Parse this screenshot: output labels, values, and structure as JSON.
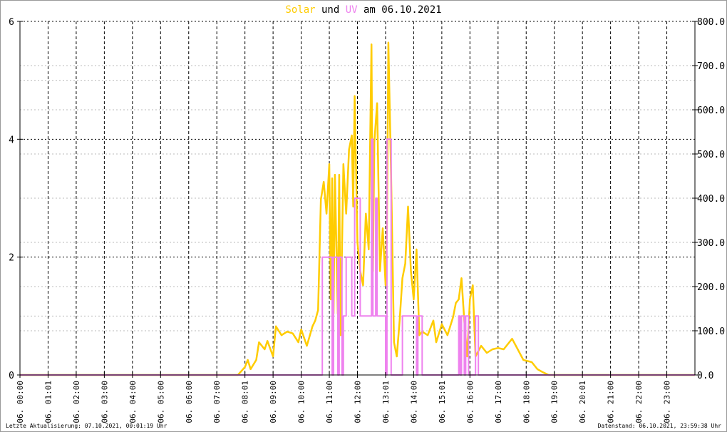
{
  "chart_data": {
    "type": "line",
    "title_parts": [
      {
        "text": "Solar",
        "color": "#ffcc00"
      },
      {
        "text": " und ",
        "color": "#000000"
      },
      {
        "text": "UV",
        "color": "#ee82ee"
      },
      {
        "text": " am 06.10.2021",
        "color": "#000000"
      }
    ],
    "x_range_hours": [
      0,
      24
    ],
    "x_ticks": [
      "06. 00:00",
      "06. 01:01",
      "06. 02:00",
      "06. 03:00",
      "06. 04:00",
      "06. 05:00",
      "06. 06:00",
      "06. 07:00",
      "06. 08:01",
      "06. 09:00",
      "06. 10:00",
      "06. 11:00",
      "06. 12:00",
      "06. 13:01",
      "06. 14:00",
      "06. 15:01",
      "06. 16:00",
      "06. 17:00",
      "06. 18:00",
      "06. 19:00",
      "06. 20:01",
      "06. 21:00",
      "06. 22:00",
      "06. 23:00"
    ],
    "y_left": {
      "range": [
        0,
        6
      ],
      "ticks": [
        "0",
        "2",
        "4",
        "6"
      ]
    },
    "y_right": {
      "range": [
        0,
        800
      ],
      "ticks": [
        "0.0",
        "100.0",
        "200.0",
        "300.0",
        "400.0",
        "500.0",
        "600.0",
        "700.0",
        "800.0"
      ]
    },
    "grid": true,
    "series": [
      {
        "name": "Solar",
        "axis": "right",
        "color": "#ffcc00",
        "points": [
          [
            0,
            0
          ],
          [
            7.75,
            0
          ],
          [
            8.0,
            18
          ],
          [
            8.1,
            34
          ],
          [
            8.2,
            13
          ],
          [
            8.4,
            34
          ],
          [
            8.5,
            74
          ],
          [
            8.7,
            58
          ],
          [
            8.8,
            77
          ],
          [
            9.0,
            42
          ],
          [
            9.1,
            110
          ],
          [
            9.3,
            90
          ],
          [
            9.5,
            98
          ],
          [
            9.7,
            94
          ],
          [
            9.9,
            74
          ],
          [
            10.0,
            103
          ],
          [
            10.2,
            66
          ],
          [
            10.4,
            110
          ],
          [
            10.5,
            123
          ],
          [
            10.6,
            147
          ],
          [
            10.7,
            397
          ],
          [
            10.8,
            437
          ],
          [
            10.9,
            365
          ],
          [
            11.0,
            477
          ],
          [
            11.05,
            171
          ],
          [
            11.1,
            445
          ],
          [
            11.15,
            139
          ],
          [
            11.2,
            453
          ],
          [
            11.3,
            139
          ],
          [
            11.35,
            453
          ],
          [
            11.4,
            90
          ],
          [
            11.5,
            477
          ],
          [
            11.6,
            365
          ],
          [
            11.7,
            510
          ],
          [
            11.8,
            542
          ],
          [
            11.85,
            381
          ],
          [
            11.9,
            631
          ],
          [
            12.0,
            300
          ],
          [
            12.1,
            235
          ],
          [
            12.2,
            203
          ],
          [
            12.3,
            365
          ],
          [
            12.4,
            284
          ],
          [
            12.5,
            748
          ],
          [
            12.55,
            235
          ],
          [
            12.6,
            526
          ],
          [
            12.7,
            615
          ],
          [
            12.8,
            235
          ],
          [
            12.9,
            332
          ],
          [
            13.0,
            203
          ],
          [
            13.05,
            332
          ],
          [
            13.1,
            752
          ],
          [
            13.2,
            445
          ],
          [
            13.3,
            74
          ],
          [
            13.4,
            42
          ],
          [
            13.5,
            123
          ],
          [
            13.6,
            219
          ],
          [
            13.7,
            252
          ],
          [
            13.8,
            381
          ],
          [
            13.9,
            235
          ],
          [
            14.0,
            171
          ],
          [
            14.1,
            284
          ],
          [
            14.2,
            90
          ],
          [
            14.3,
            98
          ],
          [
            14.5,
            90
          ],
          [
            14.7,
            123
          ],
          [
            14.8,
            74
          ],
          [
            15.0,
            115
          ],
          [
            15.2,
            90
          ],
          [
            15.4,
            131
          ],
          [
            15.5,
            163
          ],
          [
            15.6,
            171
          ],
          [
            15.7,
            219
          ],
          [
            15.8,
            123
          ],
          [
            15.9,
            42
          ],
          [
            16.0,
            171
          ],
          [
            16.1,
            203
          ],
          [
            16.2,
            42
          ],
          [
            16.4,
            66
          ],
          [
            16.6,
            50
          ],
          [
            16.8,
            58
          ],
          [
            17.0,
            61
          ],
          [
            17.2,
            58
          ],
          [
            17.5,
            82
          ],
          [
            17.7,
            58
          ],
          [
            17.9,
            34
          ],
          [
            18.2,
            29
          ],
          [
            18.4,
            13
          ],
          [
            18.6,
            6
          ],
          [
            18.8,
            0
          ],
          [
            24,
            0
          ]
        ]
      },
      {
        "name": "UV",
        "axis": "left",
        "color": "#ee82ee",
        "step": true,
        "points": [
          [
            0,
            0
          ],
          [
            10.75,
            2
          ],
          [
            11.1,
            0
          ],
          [
            11.15,
            2
          ],
          [
            11.3,
            0
          ],
          [
            11.35,
            2
          ],
          [
            11.45,
            0
          ],
          [
            11.5,
            1
          ],
          [
            11.6,
            2
          ],
          [
            11.8,
            1
          ],
          [
            11.9,
            3
          ],
          [
            12.1,
            1
          ],
          [
            12.5,
            4
          ],
          [
            12.55,
            1
          ],
          [
            12.65,
            3
          ],
          [
            12.7,
            1
          ],
          [
            13.0,
            0
          ],
          [
            13.05,
            4
          ],
          [
            13.2,
            0
          ],
          [
            13.6,
            1
          ],
          [
            14.1,
            0
          ],
          [
            14.15,
            1
          ],
          [
            14.3,
            0
          ],
          [
            15.6,
            1
          ],
          [
            15.65,
            0
          ],
          [
            15.7,
            1
          ],
          [
            15.8,
            0
          ],
          [
            15.85,
            1
          ],
          [
            15.95,
            0
          ],
          [
            16.2,
            1
          ],
          [
            16.3,
            0
          ],
          [
            24,
            0
          ]
        ]
      }
    ]
  },
  "footer": {
    "left": "Letzte Aktualisierung: 07.10.2021, 00:01:19 Uhr",
    "right": "Datenstand: 06.10.2021, 23:59:38 Uhr"
  }
}
